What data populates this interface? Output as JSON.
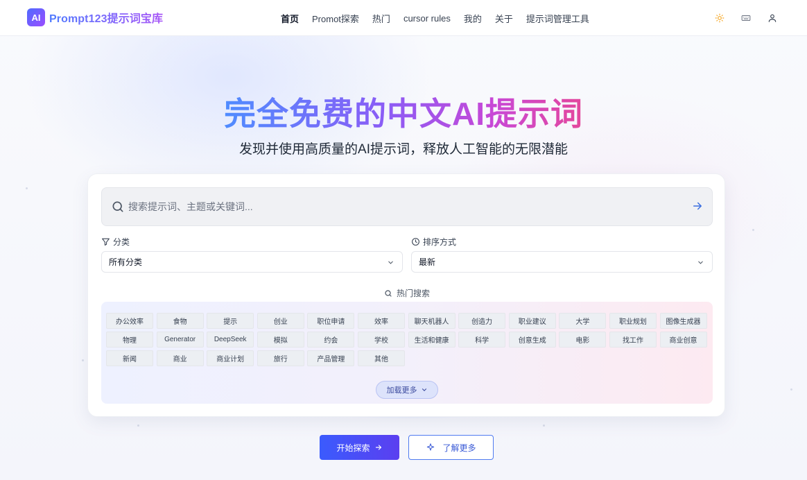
{
  "brand": {
    "badge": "AI",
    "name": "Prompt123提示词宝库"
  },
  "nav": {
    "items": [
      {
        "label": "首页",
        "active": true
      },
      {
        "label": "Promot探索"
      },
      {
        "label": "热门"
      },
      {
        "label": "cursor rules"
      },
      {
        "label": "我的"
      },
      {
        "label": "关于"
      },
      {
        "label": "提示词管理工具"
      }
    ],
    "icons": [
      "sun-icon",
      "keyboard-icon",
      "user-icon"
    ]
  },
  "hero": {
    "title": "完全免费的中文AI提示词",
    "subtitle": "发现并使用高质量的AI提示词，释放人工智能的无限潜能"
  },
  "search": {
    "placeholder": "搜索提示词、主题或关键词..."
  },
  "filters": {
    "category": {
      "label": "分类",
      "value": "所有分类"
    },
    "sort": {
      "label": "排序方式",
      "value": "最新"
    }
  },
  "hot": {
    "title": "热门搜索",
    "tags": [
      "办公效率",
      "食物",
      "提示",
      "创业",
      "职位申请",
      "效率",
      "聊天机器人",
      "创造力",
      "职业建议",
      "大学",
      "职业规划",
      "图像生成器",
      "物理",
      "Generator",
      "DeepSeek",
      "模拟",
      "约会",
      "学校",
      "生活和健康",
      "科学",
      "创意生成",
      "电影",
      "找工作",
      "商业创意",
      "新闻",
      "商业",
      "商业计划",
      "旅行",
      "产品管理",
      "其他"
    ],
    "load_more": "加载更多"
  },
  "actions": {
    "primary": "开始探索",
    "secondary": "了解更多"
  },
  "colors": {
    "accent": "#3b5bfd",
    "brand_gradient_start": "#4f8cff",
    "brand_gradient_end": "#e4479c"
  }
}
